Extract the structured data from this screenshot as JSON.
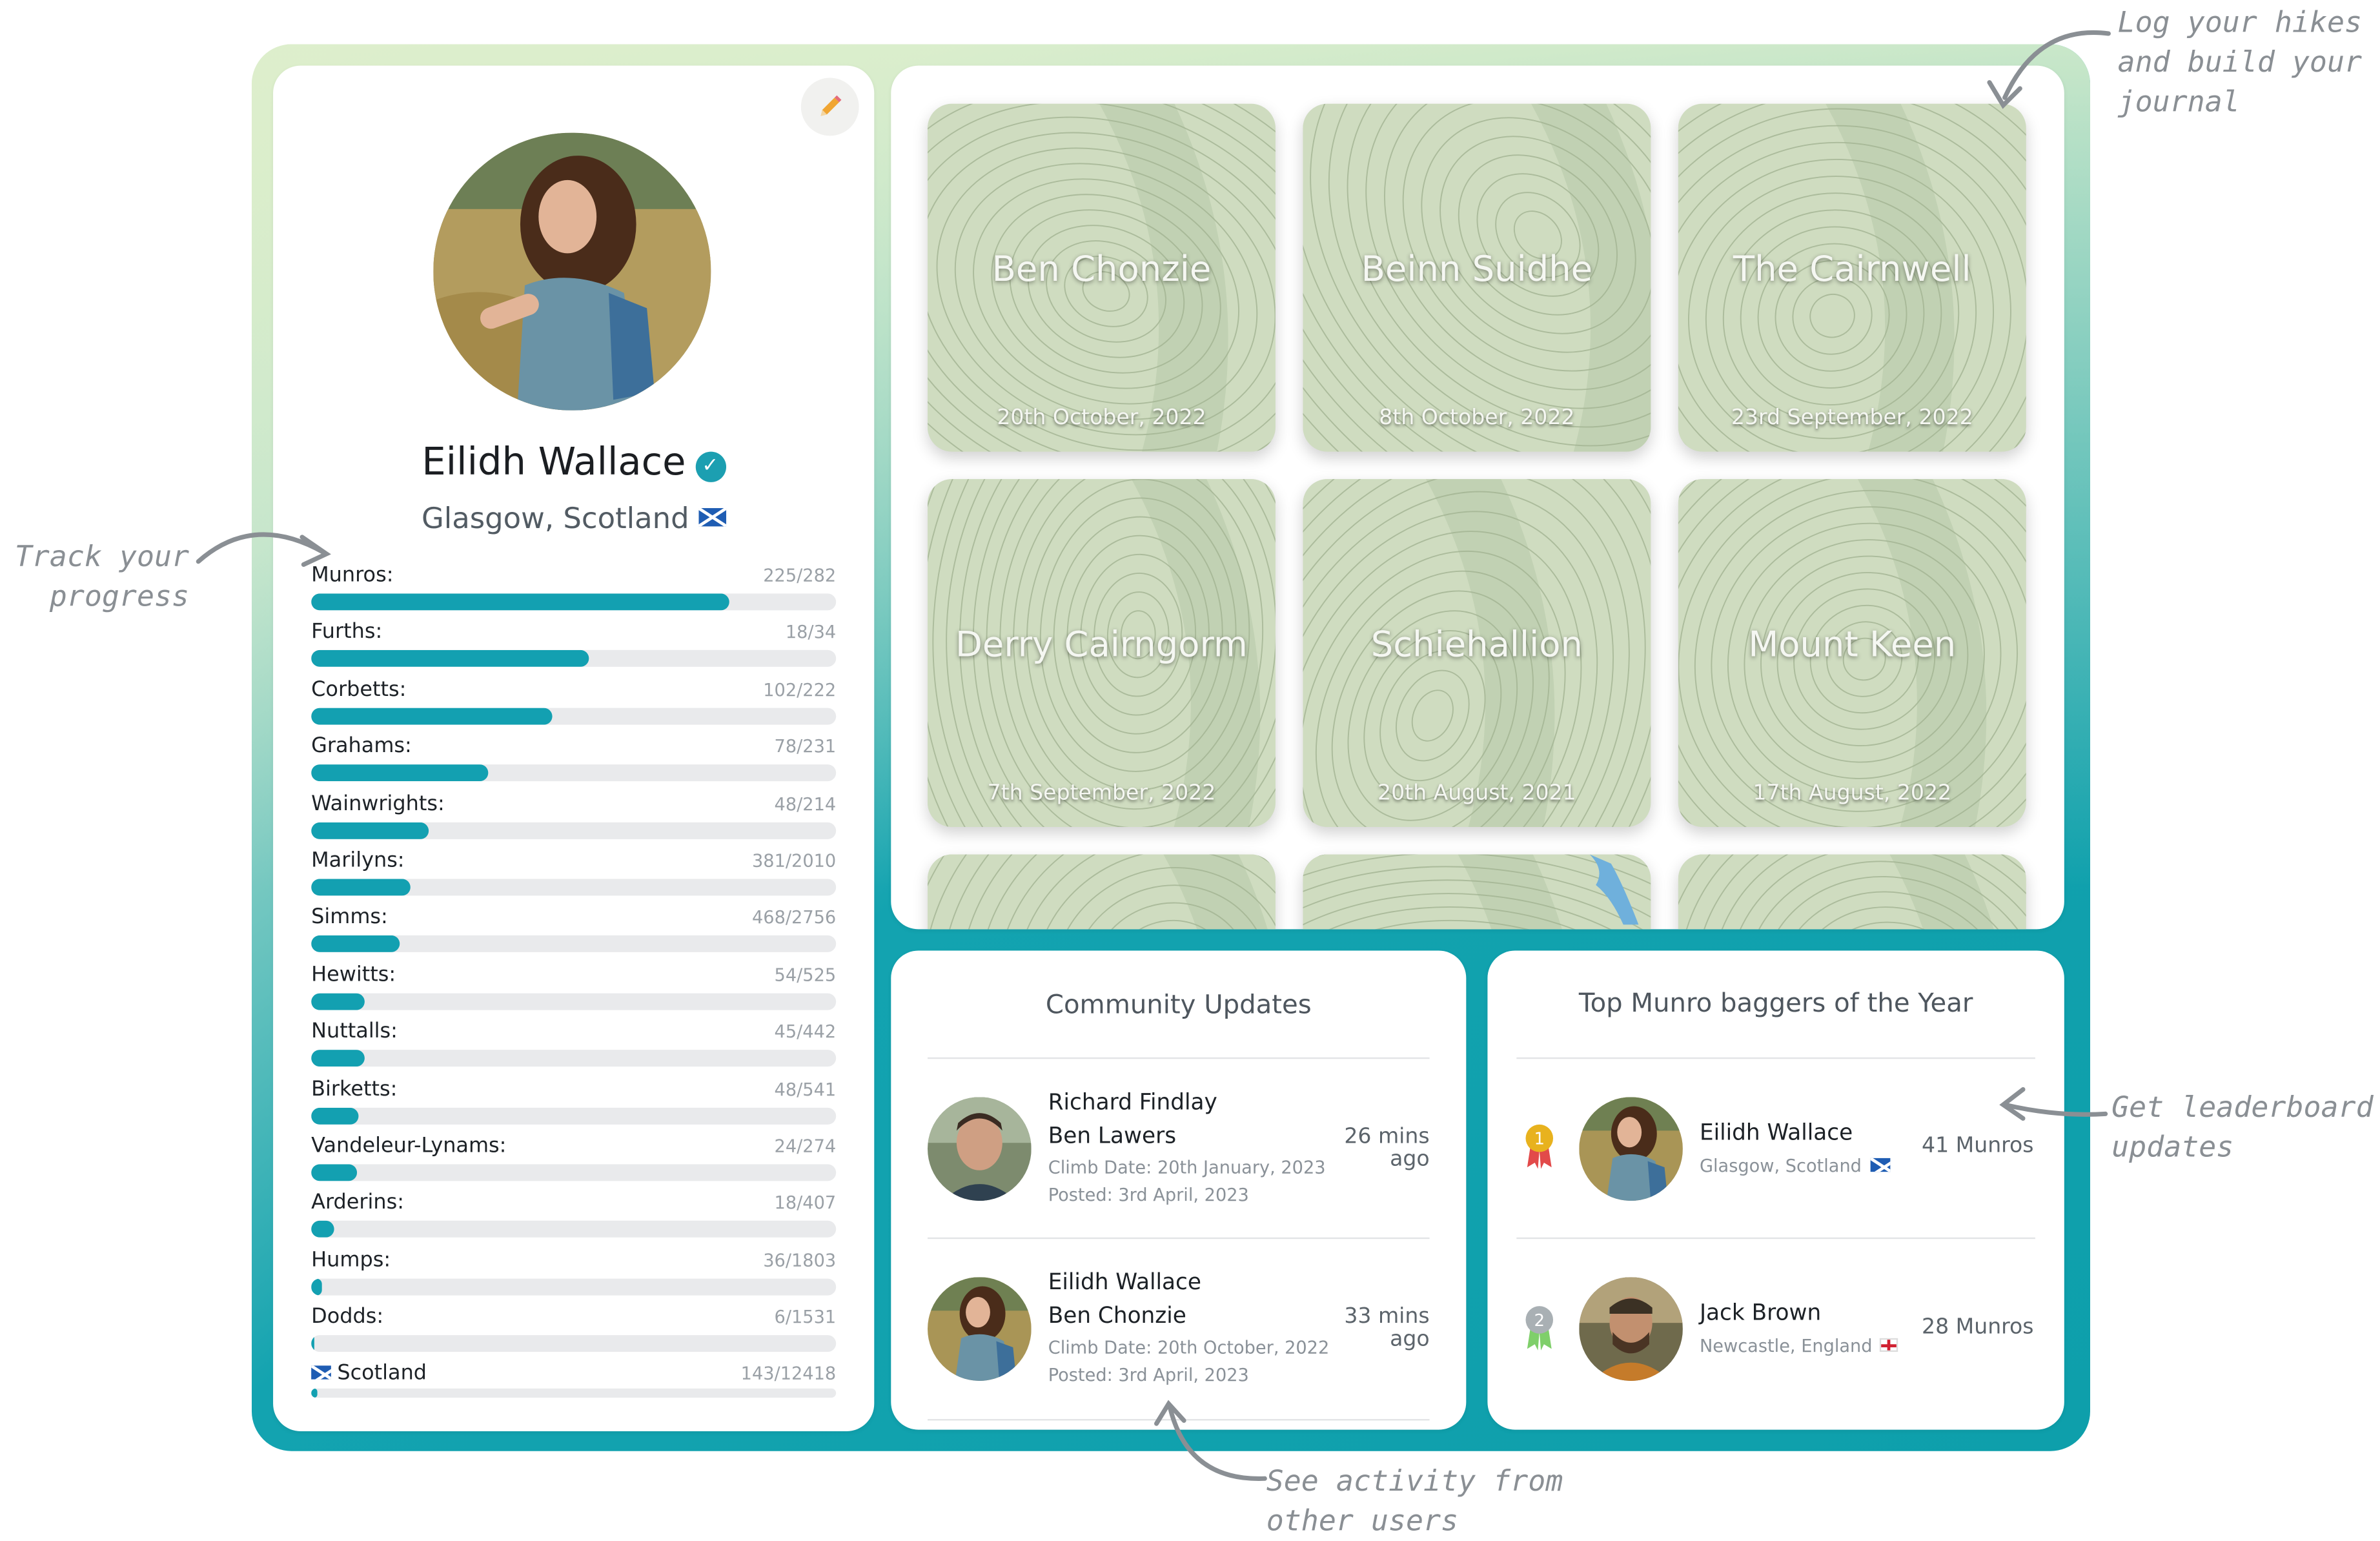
{
  "profile": {
    "name": "Eilidh Wallace",
    "location": "Glasgow, Scotland",
    "edit_icon": "pencil-icon",
    "progress": [
      {
        "label": "Munros:",
        "count": "225/282",
        "done": 225,
        "total": 282
      },
      {
        "label": "Furths:",
        "count": "18/34",
        "done": 18,
        "total": 34
      },
      {
        "label": "Corbetts:",
        "count": "102/222",
        "done": 102,
        "total": 222
      },
      {
        "label": "Grahams:",
        "count": "78/231",
        "done": 78,
        "total": 231
      },
      {
        "label": "Wainwrights:",
        "count": "48/214",
        "done": 48,
        "total": 214
      },
      {
        "label": "Marilyns:",
        "count": "381/2010",
        "done": 381,
        "total": 2010
      },
      {
        "label": "Simms:",
        "count": "468/2756",
        "done": 468,
        "total": 2756
      },
      {
        "label": "Hewitts:",
        "count": "54/525",
        "done": 54,
        "total": 525
      },
      {
        "label": "Nuttalls:",
        "count": "45/442",
        "done": 45,
        "total": 442
      },
      {
        "label": "Birketts:",
        "count": "48/541",
        "done": 48,
        "total": 541
      },
      {
        "label": "Vandeleur-Lynams:",
        "count": "24/274",
        "done": 24,
        "total": 274
      },
      {
        "label": "Arderins:",
        "count": "18/407",
        "done": 18,
        "total": 407
      },
      {
        "label": "Humps:",
        "count": "36/1803",
        "done": 36,
        "total": 1803
      },
      {
        "label": "Dodds:",
        "count": "6/1531",
        "done": 6,
        "total": 1531
      },
      {
        "label": "Scotland",
        "count": "143/12418",
        "done": 143,
        "total": 12418
      }
    ]
  },
  "hikes": [
    {
      "name": "Ben Chonzie",
      "date": "20th October, 2022"
    },
    {
      "name": "Beinn Suidhe",
      "date": "8th October, 2022"
    },
    {
      "name": "The Cairnwell",
      "date": "23rd September, 2022"
    },
    {
      "name": "Derry Cairngorm",
      "date": "7th September, 2022"
    },
    {
      "name": "Schiehallion",
      "date": "20th August, 2021"
    },
    {
      "name": "Mount Keen",
      "date": "17th August, 2022"
    }
  ],
  "community": {
    "title": "Community Updates",
    "items": [
      {
        "user": "Richard Findlay",
        "hill": "Ben Lawers",
        "climb": "Climb Date: 20th January, 2023",
        "posted": "Posted: 3rd April, 2023",
        "ago_1": "26 mins",
        "ago_2": "ago"
      },
      {
        "user": "Eilidh Wallace",
        "hill": "Ben Chonzie",
        "climb": "Climb Date: 20th October, 2022",
        "posted": "Posted: 3rd April, 2023",
        "ago_1": "33 mins",
        "ago_2": "ago"
      }
    ]
  },
  "leaderboard": {
    "title": "Top  Munro  baggers of the  Year",
    "items": [
      {
        "rank": "1",
        "name": "Eilidh Wallace",
        "location": "Glasgow, Scotland",
        "score": "41 Munros",
        "medal_color": "#e8b21e"
      },
      {
        "rank": "2",
        "name": "Jack Brown",
        "location": "Newcastle, England",
        "score": "28 Munros",
        "medal_color": "#a9b0b4"
      }
    ]
  },
  "annotations": {
    "journal": [
      "Log your hikes",
      "and build your",
      "journal"
    ],
    "progress": [
      "Track your",
      "progress"
    ],
    "leaderboard": [
      "Get  leaderboard",
      "updates"
    ],
    "activity": [
      "See  activity  from",
      "other  users"
    ]
  },
  "colors": {
    "accent": "#13a0b1",
    "map": "#cfdcc0"
  }
}
